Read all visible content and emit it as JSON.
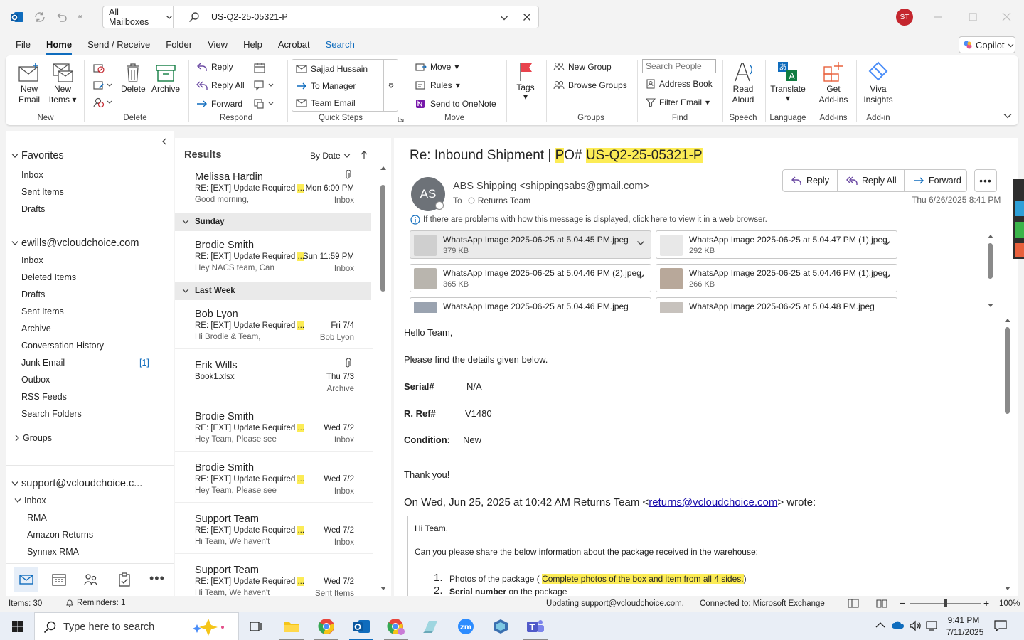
{
  "titlebar": {
    "mailbox_scope": "All Mailboxes",
    "search_value": "US-Q2-25-05321-P",
    "avatar_initials": "ST",
    "avatar_color": "#c4262e",
    "brand_color": "#0f6cbd"
  },
  "menu": {
    "file": "File",
    "home": "Home",
    "send_receive": "Send / Receive",
    "folder": "Folder",
    "view": "View",
    "help": "Help",
    "acrobat": "Acrobat",
    "search": "Search",
    "copilot": "Copilot"
  },
  "ribbon": {
    "new_email": "New\nEmail",
    "new_email_1": "New",
    "new_email_2": "Email",
    "new_items_1": "New",
    "new_items_2": "Items",
    "delete": "Delete",
    "archive": "Archive",
    "reply": "Reply",
    "reply_all": "Reply All",
    "forward": "Forward",
    "qs_1": "Sajjad Hussain",
    "qs_2": "To Manager",
    "qs_3": "Team Email",
    "move": "Move",
    "rules": "Rules",
    "onenote": "Send to OneNote",
    "tags": "Tags",
    "new_group": "New Group",
    "browse_groups": "Browse Groups",
    "search_people": "Search People",
    "address_book": "Address Book",
    "filter_email": "Filter Email",
    "read_aloud_1": "Read",
    "read_aloud_2": "Aloud",
    "translate": "Translate",
    "get_addins_1": "Get",
    "get_addins_2": "Add-ins",
    "viva_1": "Viva",
    "viva_2": "Insights",
    "groups": {
      "new": "New",
      "delete": "Delete",
      "respond": "Respond",
      "quick_steps": "Quick Steps",
      "move": "Move",
      "groups": "Groups",
      "find": "Find",
      "speech": "Speech",
      "language": "Language",
      "addins": "Add-ins",
      "addin": "Add-in"
    }
  },
  "folders": {
    "favorites": "Favorites",
    "fav_inbox": "Inbox",
    "fav_sent": "Sent Items",
    "fav_drafts": "Drafts",
    "account1": "ewills@vcloudchoice.com",
    "a1_inbox": "Inbox",
    "a1_deleted": "Deleted Items",
    "a1_drafts": "Drafts",
    "a1_sent": "Sent Items",
    "a1_archive": "Archive",
    "a1_conv": "Conversation History",
    "a1_junk": "Junk Email",
    "a1_junk_count": "[1]",
    "a1_outbox": "Outbox",
    "a1_rss": "RSS Feeds",
    "a1_searchf": "Search Folders",
    "groups": "Groups",
    "account2": "support@vcloudchoice.c...",
    "a2_inbox": "Inbox",
    "a2_rma": "RMA",
    "a2_amazon": "Amazon Returns",
    "a2_synnex": "Synnex RMA"
  },
  "list": {
    "title": "Results",
    "sort": "By Date",
    "group_sunday": "Sunday",
    "group_lastweek": "Last Week",
    "items": [
      {
        "sender": "Melissa Hardin",
        "subject": "RE: [EXT] Update Required",
        "preview": "Good morning,",
        "date": "Mon 6:00 PM",
        "folder": "Inbox"
      },
      {
        "sender": "Brodie Smith",
        "subject": "RE: [EXT] Update Required",
        "preview": "Hey NACS team,  Can",
        "date": "Sun 11:59 PM",
        "folder": "Inbox"
      },
      {
        "sender": "Bob Lyon",
        "subject": "RE: [EXT] Update Required",
        "preview": "Hi Brodie & Team,",
        "date": "Fri 7/4",
        "folder": "Bob Lyon"
      },
      {
        "sender": "Erik Wills",
        "subject": "Book1.xlsx",
        "preview": "",
        "date": "Thu 7/3",
        "folder": "Archive"
      },
      {
        "sender": "Brodie Smith",
        "subject": "RE: [EXT] Update Required",
        "preview": "Hey Team,  Please see",
        "date": "Wed 7/2",
        "folder": "Inbox"
      },
      {
        "sender": "Brodie Smith",
        "subject": "RE: [EXT] Update Required",
        "preview": "Hey Team,  Please see",
        "date": "Wed 7/2",
        "folder": "Inbox"
      },
      {
        "sender": "Support Team",
        "subject": "RE: [EXT] Update Required",
        "preview": "Hi Team,  We haven't",
        "date": "Wed 7/2",
        "folder": "Inbox"
      },
      {
        "sender": "Support Team",
        "subject": "RE: [EXT] Update Required",
        "preview": "Hi Team,  We haven't",
        "date": "Wed 7/2",
        "folder": "Sent Items"
      }
    ]
  },
  "email": {
    "subject_pre": "Re: Inbound Shipment | ",
    "subject_p": "P",
    "subject_o": "O# ",
    "subject_hl": "US-Q2-25-05321-P",
    "avatar": "AS",
    "from": "ABS Shipping <shippingsabs@gmail.com>",
    "to_label": "To",
    "to": "Returns Team",
    "date": "Thu 6/26/2025 8:41 PM",
    "reply": "Reply",
    "reply_all": "Reply All",
    "forward": "Forward",
    "info": "If there are problems with how this message is displayed, click here to view it in a web browser.",
    "attachments": [
      {
        "name": "WhatsApp Image 2025-06-25 at 5.04.45 PM.jpeg",
        "size": "379 KB"
      },
      {
        "name": "WhatsApp Image 2025-06-25 at 5.04.47 PM (1).jpeg",
        "size": "292 KB"
      },
      {
        "name": "WhatsApp Image 2025-06-25 at 5.04.46 PM (2).jpeg",
        "size": "365 KB"
      },
      {
        "name": "WhatsApp Image 2025-06-25 at 5.04.46 PM (1).jpeg",
        "size": "266 KB"
      },
      {
        "name": "WhatsApp Image 2025-06-25 at 5.04.46 PM.jpeg",
        "size": ""
      },
      {
        "name": "WhatsApp Image 2025-06-25 at 5.04.48 PM.jpeg",
        "size": ""
      }
    ],
    "body": {
      "greeting": "Hello Team,",
      "line1": "Please find the details given below.",
      "serial_label": "Serial#",
      "serial": "N/A",
      "ref_label": "R. Ref#",
      "ref": "V1480",
      "cond_label": "Condition:",
      "cond": "New",
      "thanks": "Thank you!",
      "quote_pre": "On Wed, Jun 25, 2025 at 10:42 AM Returns Team <",
      "quote_link": "returns@vcloudchoice.com",
      "quote_post": "> wrote:",
      "q_hi": "Hi Team,",
      "q_ask": "Can you please share the below information about the package received in the warehouse:",
      "q_li1_pre": "Photos of the package (",
      "q_li1_hl": "Complete photos of the box and item from all 4 sides.",
      "q_li1_post": ")",
      "q_li2_bold": "Serial number",
      "q_li2_rest": " on the package"
    }
  },
  "status": {
    "items": "Items: 30",
    "reminders": "Reminders: 1",
    "updating": "Updating support@vcloudchoice.com.",
    "connected": "Connected to: Microsoft Exchange",
    "zoom": "100%",
    "zoom_level": 0.5
  },
  "taskbar": {
    "search_placeholder": "Type here to search",
    "time": "9:41 PM",
    "date": "7/11/2025"
  }
}
